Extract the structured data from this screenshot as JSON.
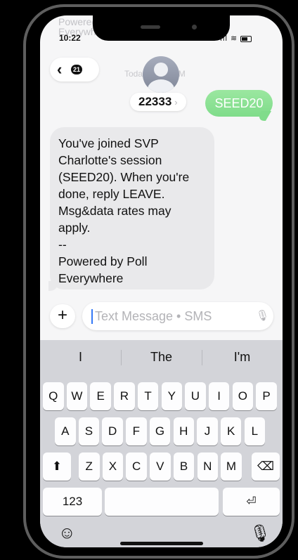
{
  "status": {
    "time": "10:22",
    "ghost_text": "Powered\nEverywhere"
  },
  "nav": {
    "back_badge": "21",
    "ghost_date": "Today 10:22 PM"
  },
  "contact": {
    "name": "22333"
  },
  "messages": {
    "sent": "SEED20",
    "received": "You've joined SVP\nCharlotte's session\n(SEED20). When you're\ndone, reply LEAVE.\nMsg&data rates may\napply.\n--\nPowered by Poll\nEverywhere"
  },
  "composer": {
    "placeholder": "Text Message • SMS"
  },
  "keyboard": {
    "suggestions": [
      "I",
      "The",
      "I'm"
    ],
    "row1": [
      "Q",
      "W",
      "E",
      "R",
      "T",
      "Y",
      "U",
      "I",
      "O",
      "P"
    ],
    "row2": [
      "A",
      "S",
      "D",
      "F",
      "G",
      "H",
      "J",
      "K",
      "L"
    ],
    "row3": [
      "Z",
      "X",
      "C",
      "V",
      "B",
      "N",
      "M"
    ],
    "numbers_label": "123"
  },
  "icons": {
    "back": "chevron-left-icon",
    "shift": "shift-icon",
    "delete": "delete-icon",
    "return": "return-icon",
    "emoji": "emoji-icon",
    "mic": "microphone-icon",
    "plus": "plus-icon"
  },
  "colors": {
    "sent_bubble": "#86df8f",
    "received_bubble": "#e9e9eb",
    "caret": "#3478f6"
  }
}
